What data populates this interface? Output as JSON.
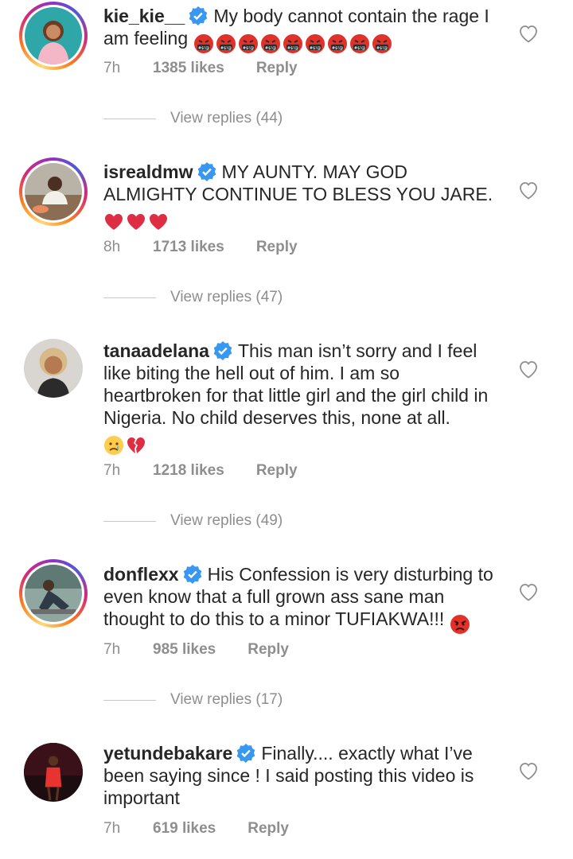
{
  "colors": {
    "text": "#262626",
    "secondary": "#8e8e8e",
    "verified": "#3897f0",
    "heart_outline": "#8e8e8e"
  },
  "comments": [
    {
      "username": "kie_kie__",
      "text": "My body cannot contain the rage I am feeling",
      "emoji": [
        "cursing-face-icon",
        "cursing-face-icon",
        "cursing-face-icon",
        "cursing-face-icon",
        "cursing-face-icon",
        "cursing-face-icon",
        "cursing-face-icon",
        "cursing-face-icon",
        "cursing-face-icon"
      ],
      "time": "7h",
      "likes": "1385 likes",
      "reply": "Reply",
      "view_replies": "View replies (44)"
    },
    {
      "username": "isrealdmw",
      "text": "MY AUNTY. MAY GOD ALMIGHTY CONTINUE TO BLESS YOU JARE.",
      "emoji": [
        "red-heart-icon",
        "red-heart-icon",
        "red-heart-icon"
      ],
      "time": "8h",
      "likes": "1713 likes",
      "reply": "Reply",
      "view_replies": "View replies (47)"
    },
    {
      "username": "tanaadelana",
      "text": "This man isn’t sorry and I feel like biting the hell out of him. I am so heartbroken for that little girl and the girl child in Nigeria. No child deserves this, none at all.",
      "emoji": [
        "crying-face-icon",
        "broken-heart-icon"
      ],
      "time": "7h",
      "likes": "1218 likes",
      "reply": "Reply",
      "view_replies": "View replies (49)"
    },
    {
      "username": "donflexx",
      "text": "His Confession is very disturbing to even know that a full grown ass sane man thought to do this to a minor TUFIAKWA!!!",
      "emoji": [
        "angry-face-icon"
      ],
      "time": "7h",
      "likes": "985 likes",
      "reply": "Reply",
      "view_replies": "View replies (17)"
    },
    {
      "username": "yetundebakare",
      "text": "Finally.... exactly what I’ve been saying since ! I said posting this video is important",
      "emoji": [],
      "time": "7h",
      "likes": "619 likes",
      "reply": "Reply"
    }
  ]
}
